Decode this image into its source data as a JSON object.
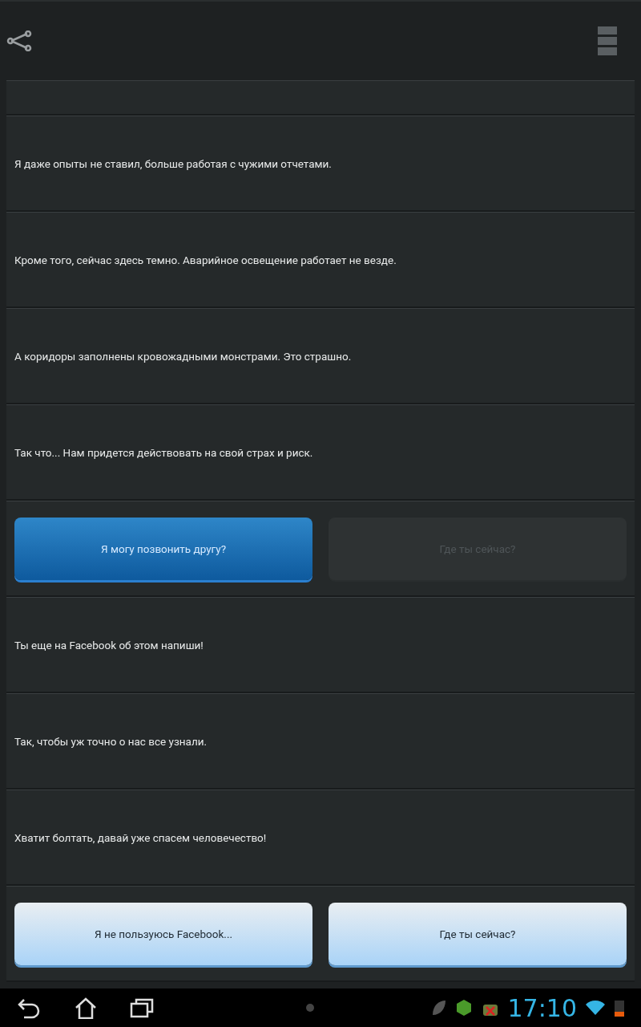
{
  "dialogue": [
    {
      "kind": "line",
      "text": "Я даже опыты не ставил, больше работая с чужими отчетами."
    },
    {
      "kind": "line",
      "text": "Кроме того, сейчас здесь темно. Аварийное освещение работает не везде."
    },
    {
      "kind": "line",
      "text": "А коридоры заполнены кровожадными монстрами. Это страшно."
    },
    {
      "kind": "line",
      "text": "Так что... Нам придется действовать на свой страх и риск."
    },
    {
      "kind": "choices",
      "options": [
        {
          "label": "Я могу позвонить другу?",
          "selected": true,
          "disabled": false
        },
        {
          "label": "Где ты сейчас?",
          "selected": false,
          "disabled": true
        }
      ]
    },
    {
      "kind": "line",
      "text": "Ты еще на Facebook об этом напиши!"
    },
    {
      "kind": "line",
      "text": "Так, чтобы уж точно о нас все узнали."
    },
    {
      "kind": "line",
      "text": "Хватит болтать, давай уже спасем человечество!"
    },
    {
      "kind": "choices",
      "options": [
        {
          "label": "Я не пользуюсь Facebook...",
          "selected": false,
          "disabled": false
        },
        {
          "label": "Где ты сейчас?",
          "selected": false,
          "disabled": false
        }
      ]
    }
  ],
  "status_bar": {
    "time": "17:10"
  }
}
